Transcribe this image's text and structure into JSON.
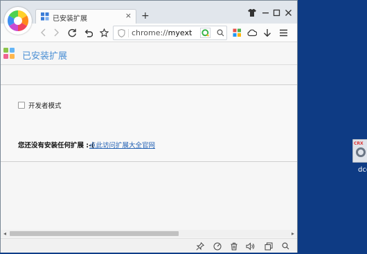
{
  "browser": {
    "tab_title": "已安装扩展",
    "new_tab_symbol": "+",
    "close_symbol": "×",
    "address_prefix": "chrome://",
    "address_highlight": "myext"
  },
  "extensions_page": {
    "header_title": "已安装扩展",
    "developer_mode_label": "开发者模式",
    "developer_mode_checked": false,
    "empty_message": "您还没有安装任何扩展 :-(",
    "store_link_label": "点此访问扩展大全官网"
  },
  "scrollbar": {
    "left_arrow": "◂",
    "right_arrow": "▸"
  },
  "desktop": {
    "icon_badge": "CRX",
    "icon_label": "dcc"
  },
  "colors": {
    "desktop_bg": "#0f3d88",
    "accent_title": "#4a8fd4",
    "link": "#2462b4"
  }
}
